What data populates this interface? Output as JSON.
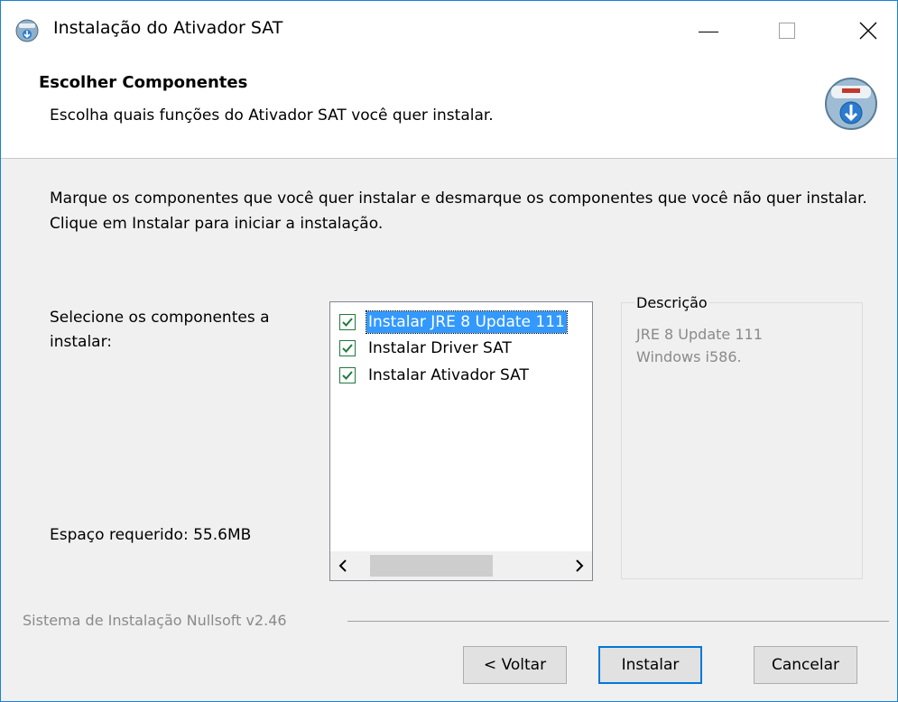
{
  "window": {
    "title": "Instalação do Ativador SAT"
  },
  "header": {
    "title": "Escolher Componentes",
    "subtitle": "Escolha quais funções do Ativador SAT você quer instalar."
  },
  "intro": "Marque os componentes que você quer instalar e desmarque os componentes que você não quer instalar. Clique em Instalar para iniciar a instalação.",
  "select_label": "Selecione os componentes a instalar:",
  "space_label": "Espaço requerido: 55.6MB",
  "components": [
    {
      "label": "Instalar JRE 8 Update 111",
      "checked": true,
      "selected": true
    },
    {
      "label": "Instalar Driver SAT",
      "checked": true,
      "selected": false
    },
    {
      "label": "Instalar Ativador SAT",
      "checked": true,
      "selected": false
    }
  ],
  "description": {
    "legend": "Descrição",
    "text": "JRE 8 Update 111\nWindows i586."
  },
  "footer": {
    "brand": "Sistema de Instalação Nullsoft v2.46"
  },
  "buttons": {
    "back": "< Voltar",
    "install": "Instalar",
    "cancel": "Cancelar"
  },
  "colors": {
    "accent": "#0078d7",
    "selection": "#3399ff",
    "check": "#1f7a3d"
  }
}
